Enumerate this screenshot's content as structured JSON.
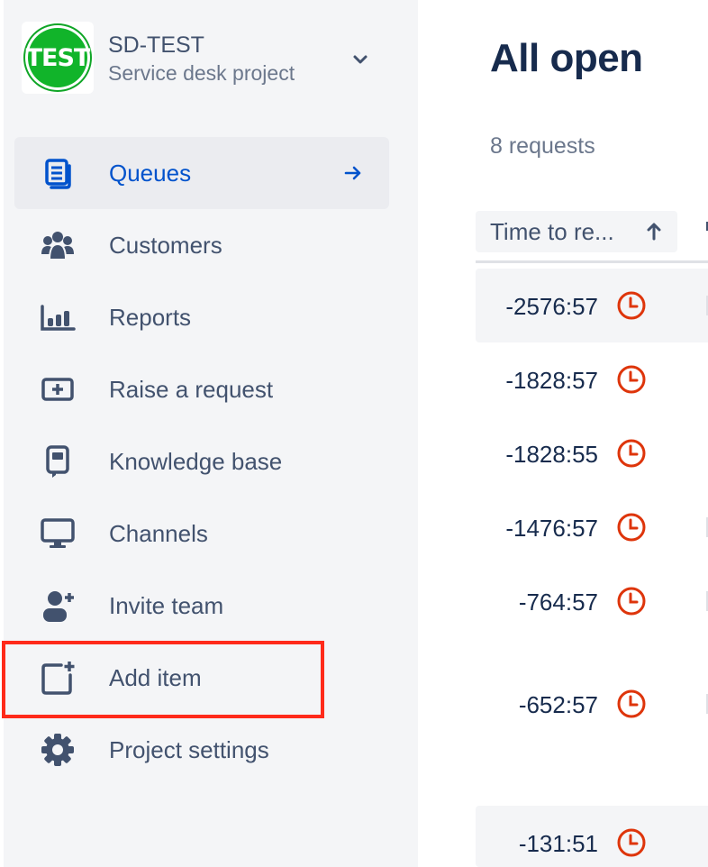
{
  "project": {
    "avatar_text": "TEST",
    "name": "SD-TEST",
    "type": "Service desk project"
  },
  "nav": {
    "items": [
      {
        "label": "Queues",
        "icon": "queues-icon",
        "active": true
      },
      {
        "label": "Customers",
        "icon": "customers-icon"
      },
      {
        "label": "Reports",
        "icon": "reports-icon"
      },
      {
        "label": "Raise a request",
        "icon": "raise-request-icon"
      },
      {
        "label": "Knowledge base",
        "icon": "knowledge-base-icon"
      },
      {
        "label": "Channels",
        "icon": "channels-icon"
      },
      {
        "label": "Invite team",
        "icon": "invite-team-icon"
      },
      {
        "label": "Add item",
        "icon": "add-item-icon",
        "highlighted": true
      },
      {
        "label": "Project settings",
        "icon": "gear-icon"
      }
    ]
  },
  "main": {
    "title": "All open",
    "request_count": "8 requests",
    "column_header": "Time to re...",
    "rows": [
      {
        "time": "-2576:57"
      },
      {
        "time": "-1828:57"
      },
      {
        "time": "-1828:55"
      },
      {
        "time": "-1476:57"
      },
      {
        "time": "-764:57"
      },
      {
        "time": "-652:57"
      },
      {
        "time": "-131:51"
      }
    ]
  },
  "colors": {
    "accent": "#0052cc",
    "text": "#42526e",
    "title": "#172b4d",
    "sidebar_bg": "#f4f5f7",
    "breach_clock": "#de350b",
    "highlight_box": "#ff2a1a",
    "avatar_green": "#11b42a"
  }
}
